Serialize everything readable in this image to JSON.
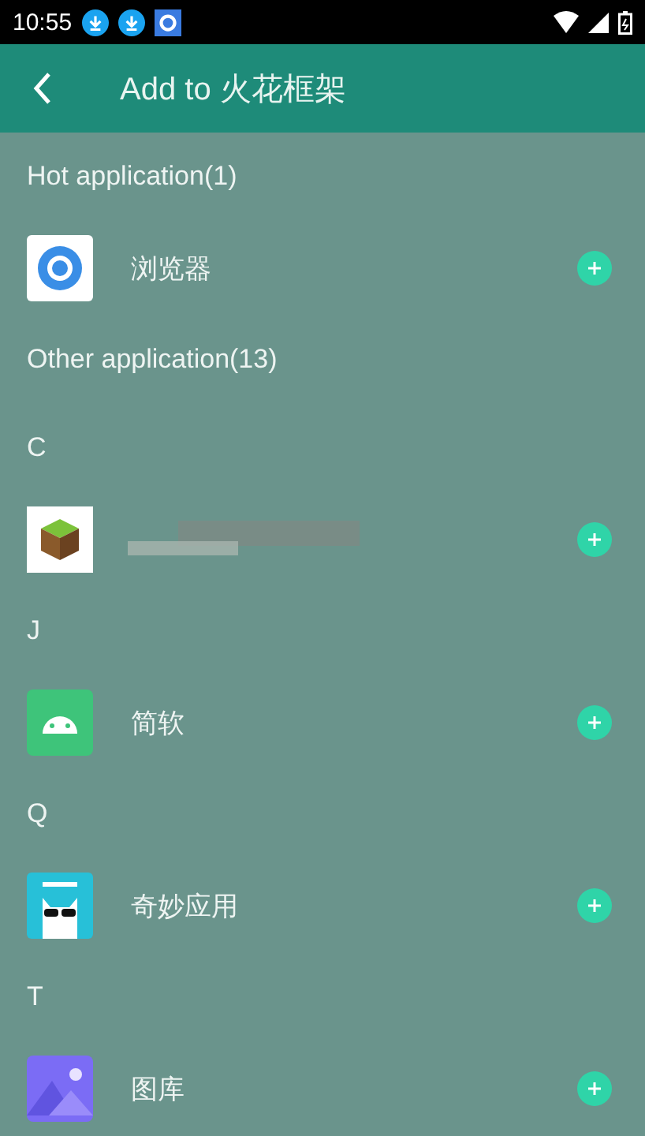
{
  "status_bar": {
    "time": "10:55"
  },
  "header": {
    "title": "Add to 火花框架"
  },
  "list": [
    {
      "kind": "section",
      "label": "Hot application(1)"
    },
    {
      "kind": "app",
      "name": "浏览器"
    },
    {
      "kind": "section",
      "label": "Other application(13)"
    },
    {
      "kind": "letter",
      "label": "C"
    },
    {
      "kind": "redacted"
    },
    {
      "kind": "letter",
      "label": "J"
    },
    {
      "kind": "app",
      "name": "简软"
    },
    {
      "kind": "letter",
      "label": "Q"
    },
    {
      "kind": "app",
      "name": "奇妙应用"
    },
    {
      "kind": "letter",
      "label": "T"
    },
    {
      "kind": "app",
      "name": "图库"
    }
  ]
}
